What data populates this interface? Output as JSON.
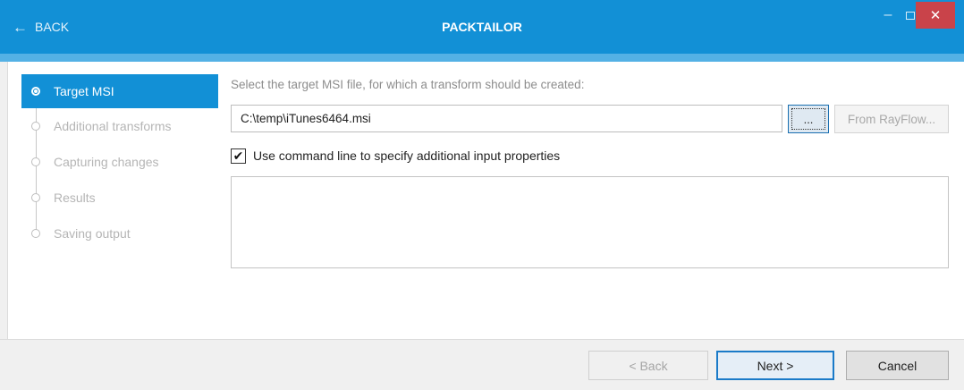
{
  "titlebar": {
    "back_label": "BACK",
    "title": "PACKTAILOR",
    "minimize": "–",
    "close": "✕"
  },
  "sidebar": {
    "steps": [
      {
        "label": "Target MSI",
        "active": true
      },
      {
        "label": "Additional transforms",
        "active": false
      },
      {
        "label": "Capturing changes",
        "active": false
      },
      {
        "label": "Results",
        "active": false
      },
      {
        "label": "Saving output",
        "active": false
      }
    ]
  },
  "main": {
    "instruction": "Select the target MSI file, for which a transform should be created:",
    "msi_path": "C:\\temp\\iTunes6464.msi",
    "browse_label": "...",
    "from_rayflow_label": "From RayFlow...",
    "use_cmdline_label": "Use command line to specify additional input properties",
    "use_cmdline_checked": true,
    "cmdline_text": ""
  },
  "footer": {
    "back_label": "< Back",
    "next_label": "Next >",
    "cancel_label": "Cancel"
  },
  "colors": {
    "accent": "#1290d6",
    "accent_light": "#54b1e5",
    "close_red": "#c9434a"
  }
}
